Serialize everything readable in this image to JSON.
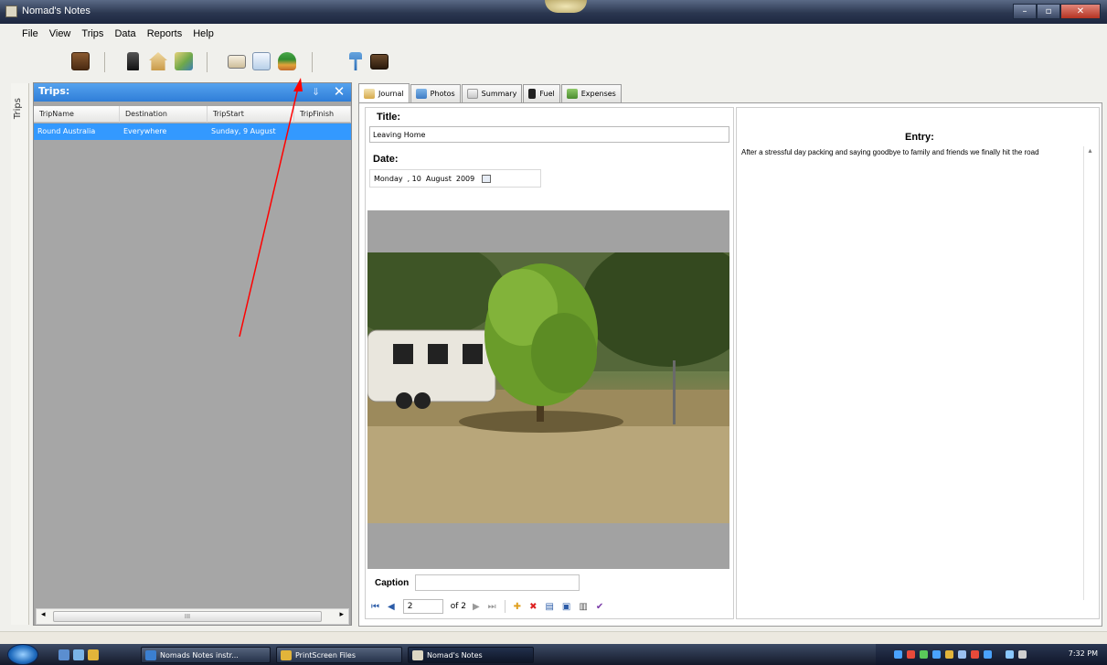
{
  "window": {
    "title": "Nomad's Notes"
  },
  "menu": [
    "File",
    "View",
    "Trips",
    "Data",
    "Reports",
    "Help"
  ],
  "side_tab": "Trips",
  "trips_panel": {
    "title": "Trips:",
    "columns": [
      "TripName",
      "Destination",
      "TripStart",
      "TripFinish"
    ],
    "rows": [
      [
        "Round Australia",
        "Everywhere",
        "Sunday, 9 August",
        ""
      ]
    ],
    "scroll_thumb": "III"
  },
  "tabs": [
    {
      "label": "Journal",
      "active": true
    },
    {
      "label": "Photos"
    },
    {
      "label": "Summary"
    },
    {
      "label": "Fuel"
    },
    {
      "label": "Expenses"
    }
  ],
  "journal": {
    "title_label": "Title:",
    "title_value": "Leaving Home",
    "date_label": "Date:",
    "date": {
      "weekday": "Monday",
      "day": ", 10",
      "month": "August",
      "year": "2009"
    },
    "caption_label": "Caption",
    "caption_value": "",
    "navigator": {
      "position": "2",
      "of": "of 2"
    }
  },
  "entry": {
    "label": "Entry:",
    "text": "After a stressful day packing and saying goodbye to family and friends we finally hit the road"
  },
  "taskbar": {
    "items": [
      "Nomads Notes instr...",
      "PrintScreen Files",
      "Nomad's Notes"
    ],
    "clock": "7:32 PM"
  },
  "colors": {
    "accent": "#3399ff",
    "annotation_arrow": "#ff0000"
  },
  "icons": [
    "briefcase-icon",
    "fuel-pump-icon",
    "home-icon",
    "map-icon",
    "caravan-icon",
    "chart-icon",
    "island-icon",
    "signpost-icon",
    "suitcase-icon"
  ]
}
